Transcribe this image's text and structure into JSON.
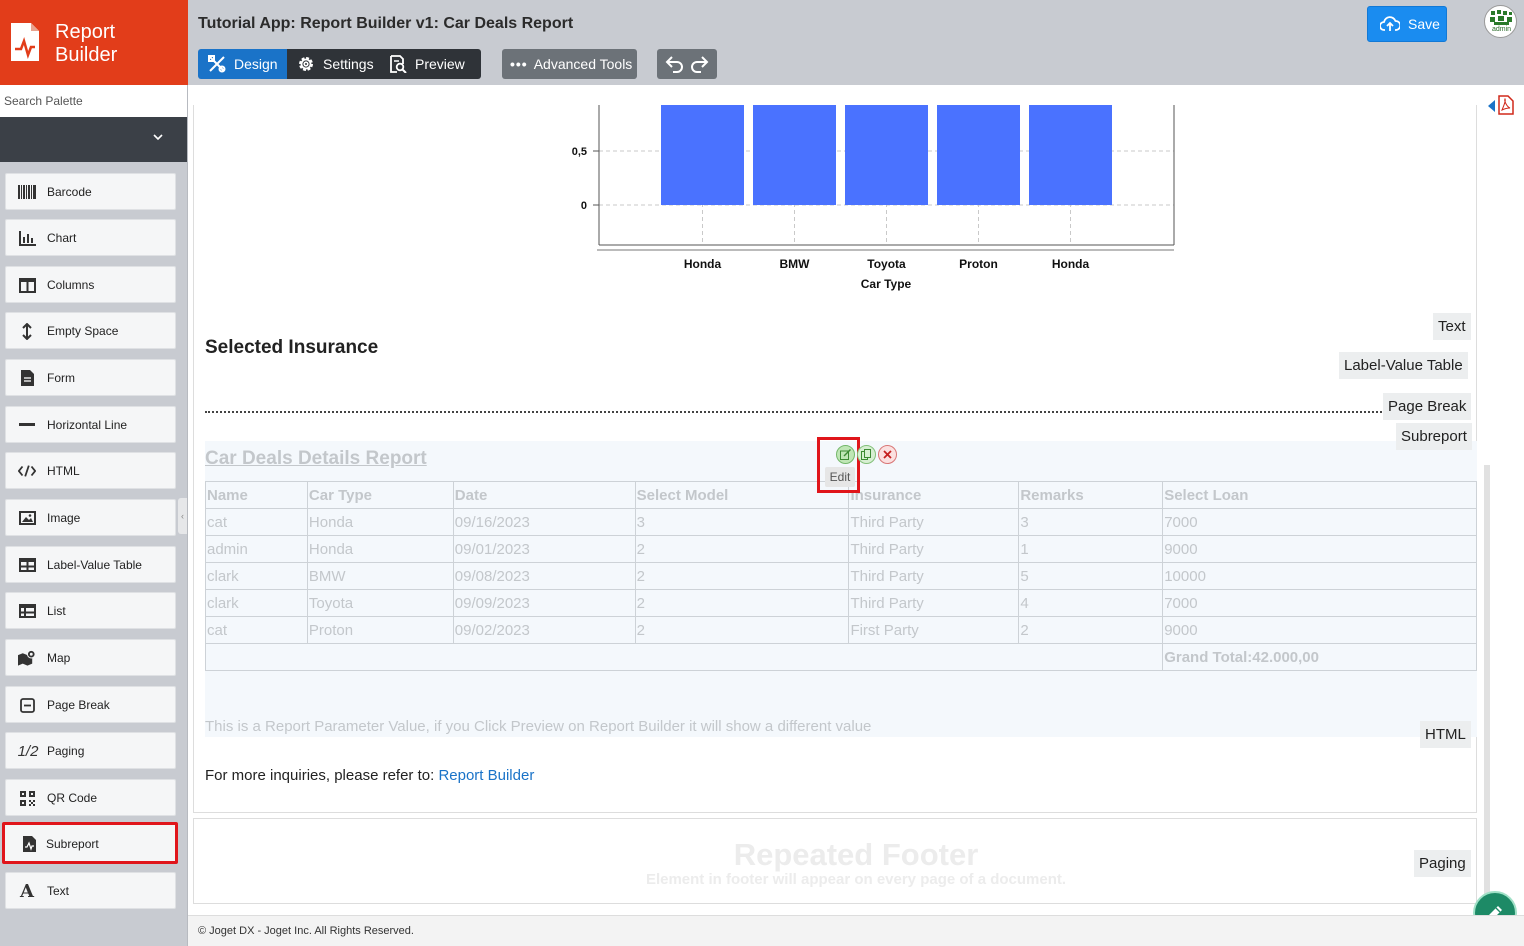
{
  "brand": {
    "line1": "Report",
    "line2": "Builder"
  },
  "palette": {
    "search_placeholder": "Search Palette",
    "items": [
      {
        "label": "Barcode",
        "icon": "barcode-icon"
      },
      {
        "label": "Chart",
        "icon": "chart-icon"
      },
      {
        "label": "Columns",
        "icon": "columns-icon"
      },
      {
        "label": "Empty Space",
        "icon": "vertical-arrows-icon"
      },
      {
        "label": "Form",
        "icon": "form-icon"
      },
      {
        "label": "Horizontal Line",
        "icon": "horizontal-line-icon"
      },
      {
        "label": "HTML",
        "icon": "code-icon"
      },
      {
        "label": "Image",
        "icon": "image-icon"
      },
      {
        "label": "Label-Value Table",
        "icon": "table-icon"
      },
      {
        "label": "List",
        "icon": "list-icon"
      },
      {
        "label": "Map",
        "icon": "map-icon"
      },
      {
        "label": "Page Break",
        "icon": "page-break-icon"
      },
      {
        "label": "Paging",
        "icon": "paging-icon",
        "glyph": "1/2"
      },
      {
        "label": "QR Code",
        "icon": "qr-code-icon"
      },
      {
        "label": "Subreport",
        "icon": "subreport-icon",
        "selected": true
      },
      {
        "label": "Text",
        "icon": "text-icon",
        "glyph": "A"
      }
    ]
  },
  "header": {
    "title": "Tutorial App: Report Builder v1: Car Deals Report",
    "design": "Design",
    "settings": "Settings",
    "preview": "Preview",
    "advanced": "Advanced Tools",
    "save": "Save",
    "avatar_label": "admin"
  },
  "chart_data": {
    "type": "bar",
    "categories": [
      "Honda",
      "BMW",
      "Toyota",
      "Proton",
      "Honda"
    ],
    "values": [
      1,
      1,
      1,
      1,
      1
    ],
    "xlabel": "Car Type",
    "ylabel": "",
    "yticks": [
      "0",
      "0,5"
    ],
    "color": "#4a72ff",
    "grid": true
  },
  "report": {
    "section_title": "Selected Insurance",
    "tags": {
      "text": "Text",
      "label_value_table": "Label-Value Table",
      "page_break": "Page Break",
      "subreport": "Subreport",
      "html": "HTML",
      "paging": "Paging"
    },
    "subreport": {
      "title": "Car Deals Details Report",
      "columns": [
        "Name",
        "Car Type",
        "Date",
        "Select Model",
        "Insurance",
        "Remarks",
        "Select Loan"
      ],
      "rows": [
        [
          "cat",
          "Honda",
          "09/16/2023",
          "3",
          "Third Party",
          "3",
          "7000"
        ],
        [
          "admin",
          "Honda",
          "09/01/2023",
          "2",
          "Third Party",
          "1",
          "9000"
        ],
        [
          "clark",
          "BMW",
          "09/08/2023",
          "2",
          "Third Party",
          "5",
          "10000"
        ],
        [
          "clark",
          "Toyota",
          "09/09/2023",
          "2",
          "Third Party",
          "4",
          "7000"
        ],
        [
          "cat",
          "Proton",
          "09/02/2023",
          "2",
          "First Party",
          "2",
          "9000"
        ]
      ],
      "grand_total": "Grand Total:42.000,00",
      "parameter_text": "This is a Report Parameter Value, if you Click Preview on Report Builder it will show a different value",
      "edit_tooltip": "Edit"
    },
    "inquiry_prefix": "For more inquiries, please refer to:",
    "inquiry_link": "Report Builder",
    "footer_title": "Repeated Footer",
    "footer_subtitle": "Element in footer will appear on every page of a document."
  },
  "status": {
    "copyright": "© Joget DX - Joget Inc. All Rights Reserved."
  }
}
